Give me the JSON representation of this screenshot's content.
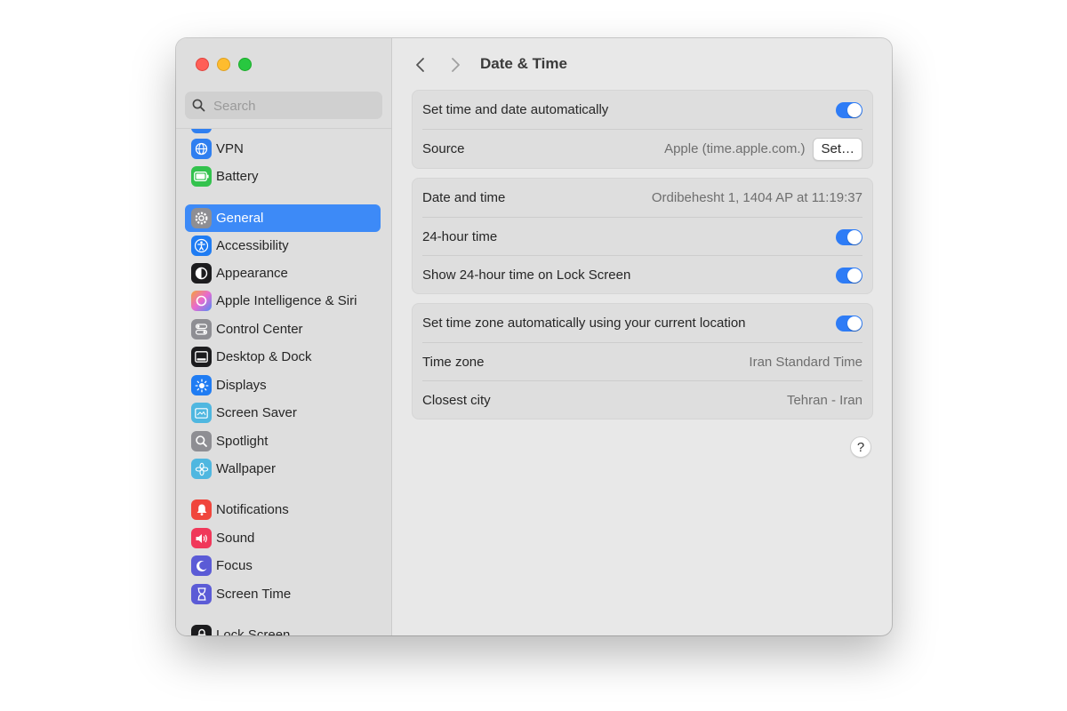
{
  "window": {
    "traffic_lights": [
      "close",
      "minimize",
      "maximize"
    ]
  },
  "sidebar": {
    "search": {
      "placeholder": "Search",
      "value": ""
    },
    "items": [
      {
        "label": "VPN",
        "icon": "globe-icon",
        "color": "#2f7ff0"
      },
      {
        "label": "Battery",
        "icon": "battery-icon",
        "color": "#33c24d"
      },
      {
        "label": "General",
        "icon": "gear-icon",
        "color": "#8e8e93",
        "selected": true
      },
      {
        "label": "Accessibility",
        "icon": "accessibility-icon",
        "color": "#1f7cf3"
      },
      {
        "label": "Appearance",
        "icon": "appearance-icon",
        "color": "#1c1c1e"
      },
      {
        "label": "Apple Intelligence & Siri",
        "icon": "siri-icon",
        "color": "#e86ad0"
      },
      {
        "label": "Control Center",
        "icon": "toggles-icon",
        "color": "#8e8e93"
      },
      {
        "label": "Desktop & Dock",
        "icon": "dock-icon",
        "color": "#1c1c1e"
      },
      {
        "label": "Displays",
        "icon": "sun-icon",
        "color": "#1f7cf3"
      },
      {
        "label": "Screen Saver",
        "icon": "screensaver-icon",
        "color": "#4fb7e0"
      },
      {
        "label": "Spotlight",
        "icon": "magnifier-icon",
        "color": "#8e8e93"
      },
      {
        "label": "Wallpaper",
        "icon": "flower-icon",
        "color": "#4fb7e0"
      },
      {
        "label": "Notifications",
        "icon": "bell-icon",
        "color": "#f0463c"
      },
      {
        "label": "Sound",
        "icon": "speaker-icon",
        "color": "#f0385a"
      },
      {
        "label": "Focus",
        "icon": "moon-icon",
        "color": "#5b5bd6"
      },
      {
        "label": "Screen Time",
        "icon": "hourglass-icon",
        "color": "#5b5bd6"
      },
      {
        "label": "Lock Screen",
        "icon": "lock-icon",
        "color": "#1c1c1e"
      }
    ]
  },
  "main": {
    "title": "Date & Time",
    "group1": {
      "auto_label": "Set time and date automatically",
      "auto_on": true,
      "source_label": "Source",
      "source_value": "Apple (time.apple.com.)",
      "set_button": "Set…"
    },
    "group2": {
      "datetime_label": "Date and time",
      "datetime_value": "Ordibehesht 1, 1404 AP at 11:19:37",
      "h24_label": "24-hour time",
      "h24_on": true,
      "lock_label": "Show 24-hour time on Lock Screen",
      "lock_on": true
    },
    "group3": {
      "tz_auto_label": "Set time zone automatically using your current location",
      "tz_auto_on": true,
      "tz_label": "Time zone",
      "tz_value": "Iran Standard Time",
      "city_label": "Closest city",
      "city_value": "Tehran - Iran"
    },
    "help_label": "?"
  },
  "colors": {
    "accent": "#3d8af7",
    "toggle_on": "#2e7cf6"
  }
}
